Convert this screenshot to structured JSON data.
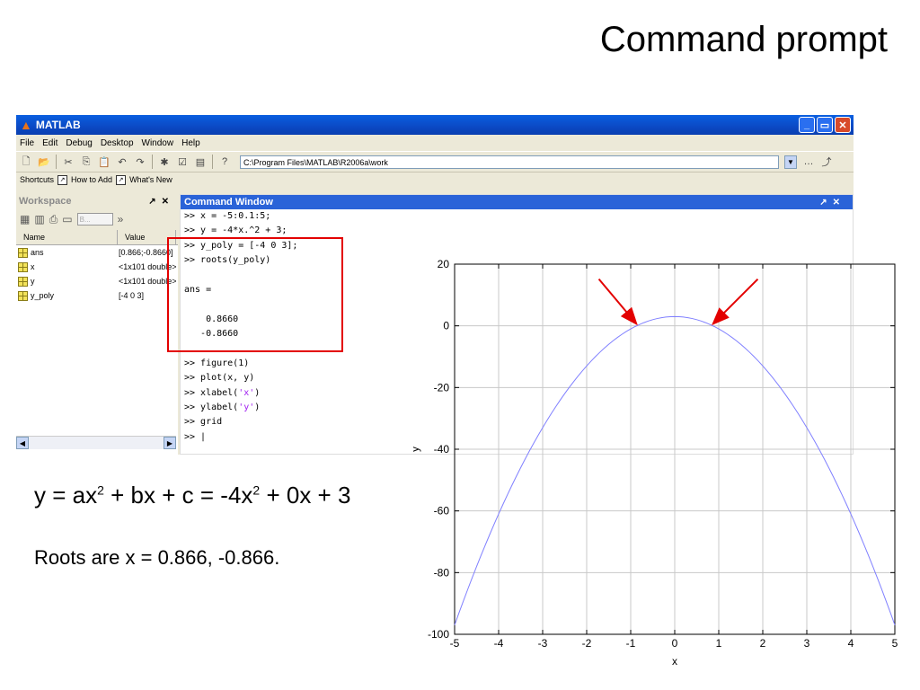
{
  "slide": {
    "title": "Command prompt",
    "equation": {
      "lhs": "y",
      "eq1": " = ",
      "a": "a",
      "x1": "x",
      "exp1": "2",
      "plus1": " + ",
      "b": "b",
      "x2": "x",
      "plus2": " + ",
      "c": "c",
      "eq2": " = ",
      "coef1": "-4",
      "x3": "x",
      "exp2": "2",
      "plus3": " + ",
      "coef2": "0",
      "x4": "x",
      "plus4": " + ",
      "coef3": "3"
    },
    "roots_text": "Roots are x = 0.866, -0.866."
  },
  "matlab": {
    "window_title": "MATLAB",
    "menu": [
      "File",
      "Edit",
      "Debug",
      "Desktop",
      "Window",
      "Help"
    ],
    "current_directory": "C:\\Program Files\\MATLAB\\R2006a\\work",
    "shortcuts": {
      "label": "Shortcuts",
      "how_to_add": "How to Add",
      "whats_new": "What's New"
    },
    "workspace": {
      "title": "Workspace",
      "select_value": "B...",
      "col_name": "Name",
      "col_value": "Value",
      "rows": [
        {
          "name": "ans",
          "value": "[0.866;-0.8660]"
        },
        {
          "name": "x",
          "value": "<1x101 double>"
        },
        {
          "name": "y",
          "value": "<1x101 double>"
        },
        {
          "name": "y_poly",
          "value": "[-4 0 3]"
        }
      ]
    },
    "command_window": {
      "title": "Command Window",
      "lines": [
        ">> x = -5:0.1:5;",
        ">> y = -4*x.^2 + 3;",
        ">> y_poly = [-4 0 3];",
        ">> roots(y_poly)",
        "",
        "ans =",
        "",
        "    0.8660",
        "   -0.8660",
        "",
        ">> figure(1)",
        ">> plot(x, y)"
      ],
      "xlabel_cmd": {
        "prefix": ">> xlabel(",
        "arg": "'x'",
        "suffix": ")"
      },
      "ylabel_cmd": {
        "prefix": ">> ylabel(",
        "arg": "'y'",
        "suffix": ")"
      },
      "grid_cmd": ">> grid",
      "prompt": ">> |"
    }
  },
  "chart_data": {
    "type": "line",
    "xlabel": "x",
    "ylabel": "y",
    "xlim": [
      -5,
      5
    ],
    "ylim": [
      -100,
      20
    ],
    "xticks": [
      -5,
      -4,
      -3,
      -2,
      -1,
      0,
      1,
      2,
      3,
      4,
      5
    ],
    "yticks": [
      -100,
      -80,
      -60,
      -40,
      -20,
      0,
      20
    ],
    "grid": true,
    "series": [
      {
        "function": "y = -4x^2 + 3",
        "x_start": -5,
        "x_step": 0.1,
        "x_end": 5,
        "color": "#8080ff"
      }
    ],
    "annotations": [
      {
        "type": "arrow",
        "points_to": [
          -0.866,
          0
        ],
        "color": "#e30000"
      },
      {
        "type": "arrow",
        "points_to": [
          0.866,
          0
        ],
        "color": "#e30000"
      }
    ]
  }
}
